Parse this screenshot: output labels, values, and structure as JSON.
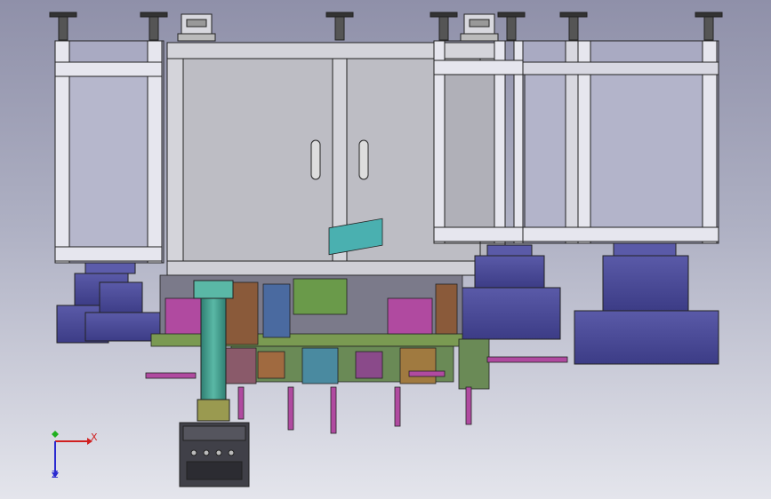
{
  "triad": {
    "x_label": "X",
    "z_label": "Z",
    "colors": {
      "x": "#d02020",
      "y": "#20b020",
      "z": "#2a2ad0"
    }
  },
  "colors": {
    "frame_face": "#e6e6ee",
    "frame_edge": "#222222",
    "cabinet_face": "#c2c2c8",
    "cabinet_inner": "#b0b0b8",
    "frame_panel": "#a9aac2",
    "motor_blue": "#4a4a96",
    "cylinder_teal": "#3f9a8a",
    "rod_magenta": "#b04aa0",
    "machine_green": "#6a9a4a",
    "machine_brown": "#8a5a3a",
    "control_box": "#404048"
  },
  "icons": [
    "cabinet-handle-icon",
    "leveling-foot-icon",
    "lifting-eye-icon",
    "coordinate-triad-icon"
  ]
}
